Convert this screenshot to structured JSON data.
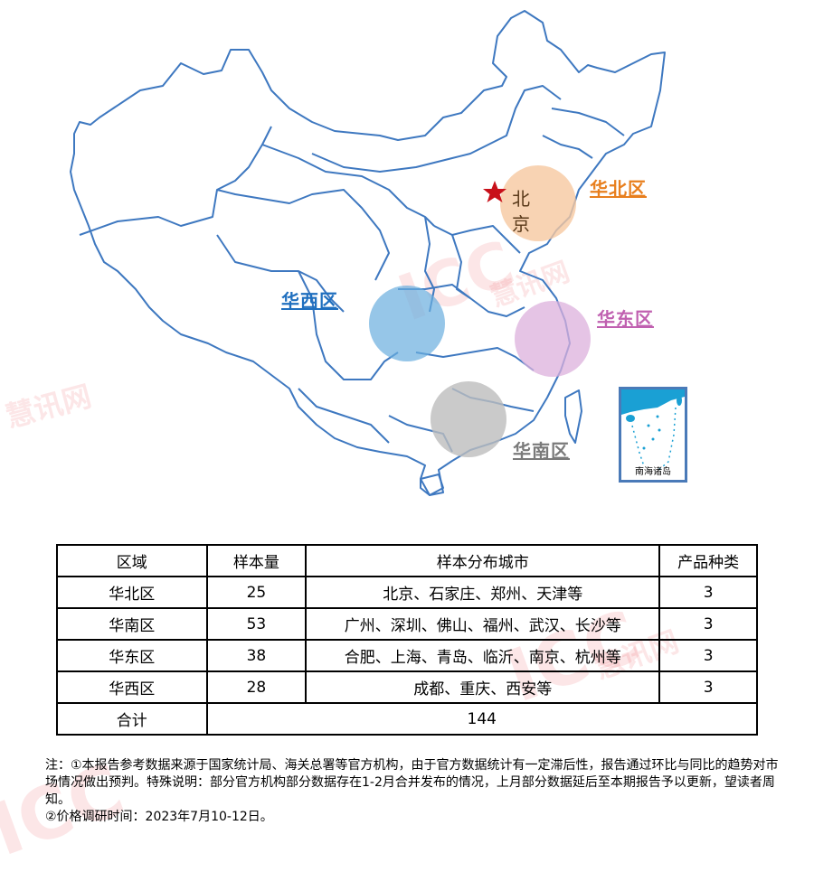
{
  "map": {
    "capital": {
      "name": "北京",
      "marker": "red-star-icon"
    },
    "regions": [
      {
        "id": "north",
        "label": "华北区",
        "color": "#e87f1e",
        "circle_color": "#f6c8a0"
      },
      {
        "id": "west",
        "label": "华西区",
        "color": "#1f6fbf",
        "circle_color": "#6aaede"
      },
      {
        "id": "east",
        "label": "华东区",
        "color": "#c060b0",
        "circle_color": "#dcb0dc"
      },
      {
        "id": "south",
        "label": "华南区",
        "color": "#7a7a7a",
        "circle_color": "#bdbdbd"
      }
    ],
    "inset_label": "南海诸岛",
    "border_color": "#3e78c0"
  },
  "watermark": {
    "brand": "慧讯网",
    "logo_text": "ICC"
  },
  "table": {
    "headers": [
      "区域",
      "样本量",
      "样本分布城市",
      "产品种类"
    ],
    "rows": [
      {
        "region": "华北区",
        "samples": "25",
        "cities": "北京、石家庄、郑州、天津等",
        "products": "3"
      },
      {
        "region": "华南区",
        "samples": "53",
        "cities": "广州、深圳、佛山、福州、武汉、长沙等",
        "products": "3"
      },
      {
        "region": "华东区",
        "samples": "38",
        "cities": "合肥、上海、青岛、临沂、南京、杭州等",
        "products": "3"
      },
      {
        "region": "华西区",
        "samples": "28",
        "cities": "成都、重庆、西安等",
        "products": "3"
      }
    ],
    "total_label": "合计",
    "total_value": "144"
  },
  "notes": [
    "注：①本报告参考数据来源于国家统计局、海关总署等官方机构，由于官方数据统计有一定滞后性，报告通过环比与同比的趋势对市场情况做出预判。特殊说明：部分官方机构部分数据存在1-2月合并发布的情况，上月部分数据延后至本期报告予以更新，望读者周知。",
    "②价格调研时间：2023年7月10-12日。"
  ]
}
